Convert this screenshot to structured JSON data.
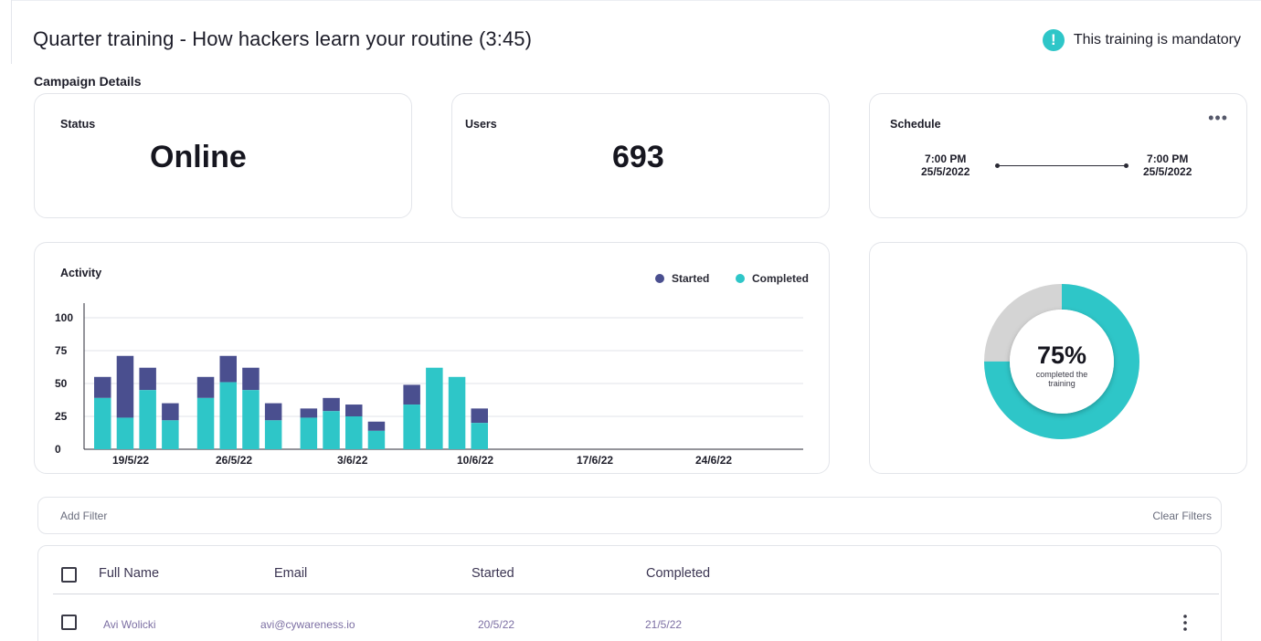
{
  "header": {
    "title": "Quarter training - How hackers learn your routine (3:45)",
    "mandatory_icon": "exclamation-circle-icon",
    "mandatory_text": "This training is mandatory"
  },
  "section": {
    "label": "Campaign Details"
  },
  "status_card": {
    "label": "Status",
    "value": "Online"
  },
  "users_card": {
    "label": "Users",
    "value": "693"
  },
  "schedule_card": {
    "label": "Schedule",
    "menu_icon": "more-horizontal-icon",
    "menu_glyph": "•••",
    "start_time": "7:00 PM",
    "start_date": "25/5/2022",
    "end_time": "7:00 PM",
    "end_date": "25/5/2022"
  },
  "activity_card": {
    "label": "Activity",
    "legend_started": "Started",
    "legend_completed": "Completed"
  },
  "colors": {
    "started": "#4a4f8f",
    "completed": "#2ec6c8",
    "remaining": "#d4d4d4",
    "accent": "#2ec6c8"
  },
  "chart_data": {
    "type": "bar",
    "stacked": true,
    "title": "Activity",
    "xlabel": "",
    "ylabel": "",
    "ylim": [
      0,
      100
    ],
    "yticks": [
      0,
      25,
      50,
      75,
      100
    ],
    "xtick_labels": [
      "19/5/22",
      "26/5/22",
      "3/6/22",
      "10/6/22",
      "17/6/22",
      "24/6/22"
    ],
    "grid": true,
    "legend": "top-right",
    "series": [
      {
        "name": "Started",
        "values": [
          55,
          71,
          62,
          35,
          55,
          71,
          62,
          35,
          31,
          39,
          34,
          21,
          49,
          62,
          55,
          31
        ]
      },
      {
        "name": "Completed",
        "values": [
          39,
          24,
          45,
          22,
          39,
          51,
          45,
          22,
          24,
          29,
          25,
          14,
          34,
          62,
          55,
          20
        ]
      }
    ],
    "notes": "Started = full bar height (dark), Completed = teal portion."
  },
  "completion_card": {
    "type": "pie",
    "percent": 75,
    "percent_label": "75%",
    "caption_line1": "completed the",
    "caption_line2": "training"
  },
  "filters": {
    "add_label": "Add Filter",
    "clear_label": "Clear Filters"
  },
  "table": {
    "columns": [
      "Full Name",
      "Email",
      "Started",
      "Completed"
    ],
    "rows": [
      {
        "name": "Avi Wolicki",
        "email": "avi@cywareness.io",
        "started": "20/5/22",
        "completed": "21/5/22",
        "menu_icon": "more-vertical-icon"
      }
    ]
  }
}
